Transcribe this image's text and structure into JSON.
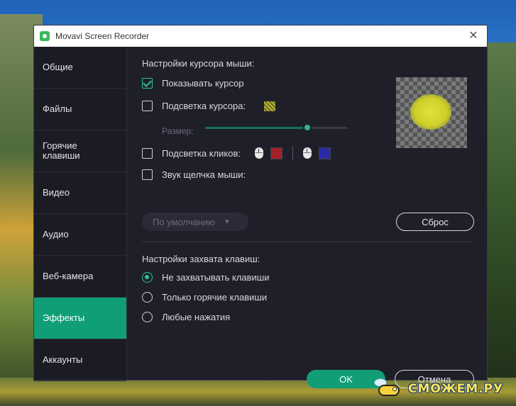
{
  "window": {
    "title": "Movavi Screen Recorder"
  },
  "sidebar": {
    "items": [
      {
        "label": "Общие"
      },
      {
        "label": "Файлы"
      },
      {
        "label": "Горячие клавиши"
      },
      {
        "label": "Видео"
      },
      {
        "label": "Аудио"
      },
      {
        "label": "Веб-камера"
      },
      {
        "label": "Эффекты",
        "active": true
      },
      {
        "label": "Аккаунты"
      }
    ]
  },
  "cursor_settings": {
    "title": "Настройки курсора мыши:",
    "show_cursor": {
      "label": "Показывать курсор",
      "checked": true
    },
    "cursor_highlight": {
      "label": "Подсветка курсора:",
      "checked": false,
      "color": "#b7b738"
    },
    "size": {
      "label": "Размер:",
      "value_fraction": 0.72
    },
    "click_highlight": {
      "label": "Подсветка кликов:",
      "checked": false,
      "left_color": "#a3202a",
      "right_color": "#2a2aa8"
    },
    "click_sound": {
      "label": "Звук щелчка мыши:",
      "checked": false
    },
    "sound_select": {
      "value": "По умолчанию"
    },
    "reset_label": "Сброс"
  },
  "key_capture": {
    "title": "Настройки захвата клавиш:",
    "options": [
      {
        "label": "Не захватывать клавиши",
        "checked": true
      },
      {
        "label": "Только горячие клавиши",
        "checked": false
      },
      {
        "label": "Любые нажатия",
        "checked": false
      }
    ]
  },
  "footer": {
    "ok_label": "OK",
    "cancel_label": "Отмена"
  },
  "watermark": {
    "text": "СМОЖЕМ.РУ"
  },
  "colors": {
    "accent": "#119e77"
  }
}
